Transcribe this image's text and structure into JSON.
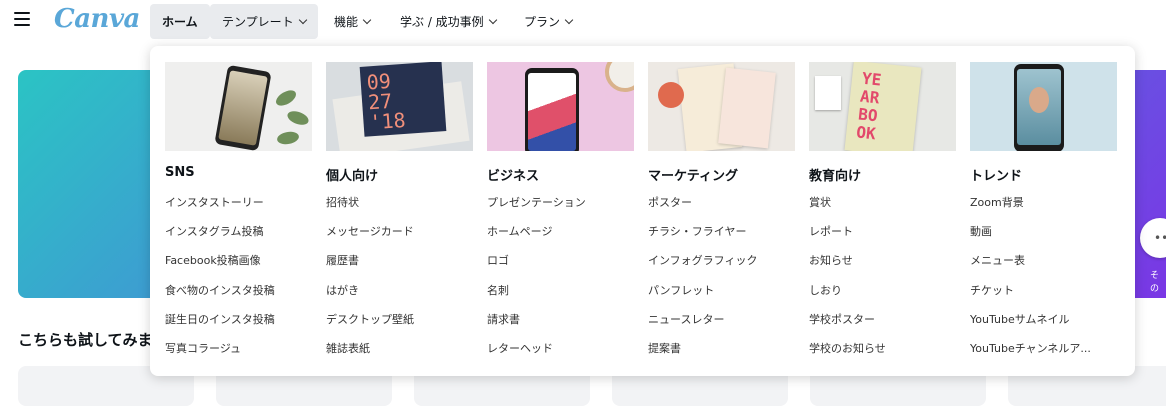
{
  "brand": {
    "logo_text": "Canva",
    "logo_color": "#5aa7d8"
  },
  "nav": {
    "home": "ホーム",
    "templates": "テンプレート",
    "features": "機能",
    "learn": "学ぶ / 成功事例",
    "plans": "プラン"
  },
  "background_page": {
    "section_title": "こちらも試してみま",
    "side_label": "その",
    "hero_gradient": [
      "#2bc4c4",
      "#4e78de",
      "#7b35e5"
    ]
  },
  "dropdown": {
    "columns": [
      {
        "title": "SNS",
        "thumb_icon": "sns-phone-thumbnail",
        "items": [
          "インスタストーリー",
          "インスタグラム投稿",
          "Facebook投稿画像",
          "食べ物のインスタ投稿",
          "誕生日のインスタ投稿",
          "写真コラージュ"
        ]
      },
      {
        "title": "個人向け",
        "thumb_icon": "invitation-card-thumbnail",
        "thumb_text": "09\n27\n'18",
        "items": [
          "招待状",
          "メッセージカード",
          "履歴書",
          "はがき",
          "デスクトップ壁紙",
          "雑誌表紙"
        ]
      },
      {
        "title": "ビジネス",
        "thumb_icon": "business-phone-thumbnail",
        "items": [
          "プレゼンテーション",
          "ホームページ",
          "ロゴ",
          "名刺",
          "請求書",
          "レターヘッド"
        ]
      },
      {
        "title": "マーケティング",
        "thumb_icon": "marketing-poster-thumbnail",
        "items": [
          "ポスター",
          "チラシ・フライヤー",
          "インフォグラフィック",
          "パンフレット",
          "ニュースレター",
          "提案書"
        ]
      },
      {
        "title": "教育向け",
        "thumb_icon": "yearbook-thumbnail",
        "thumb_text": "YE\nAR\nBO\nOK",
        "items": [
          "賞状",
          "レポート",
          "お知らせ",
          "しおり",
          "学校ポスター",
          "学校のお知らせ"
        ]
      },
      {
        "title": "トレンド",
        "thumb_icon": "trend-phone-thumbnail",
        "items": [
          "Zoom背景",
          "動画",
          "メニュー表",
          "チケット",
          "YouTubeサムネイル",
          "YouTubeチャンネルア..."
        ]
      }
    ]
  }
}
